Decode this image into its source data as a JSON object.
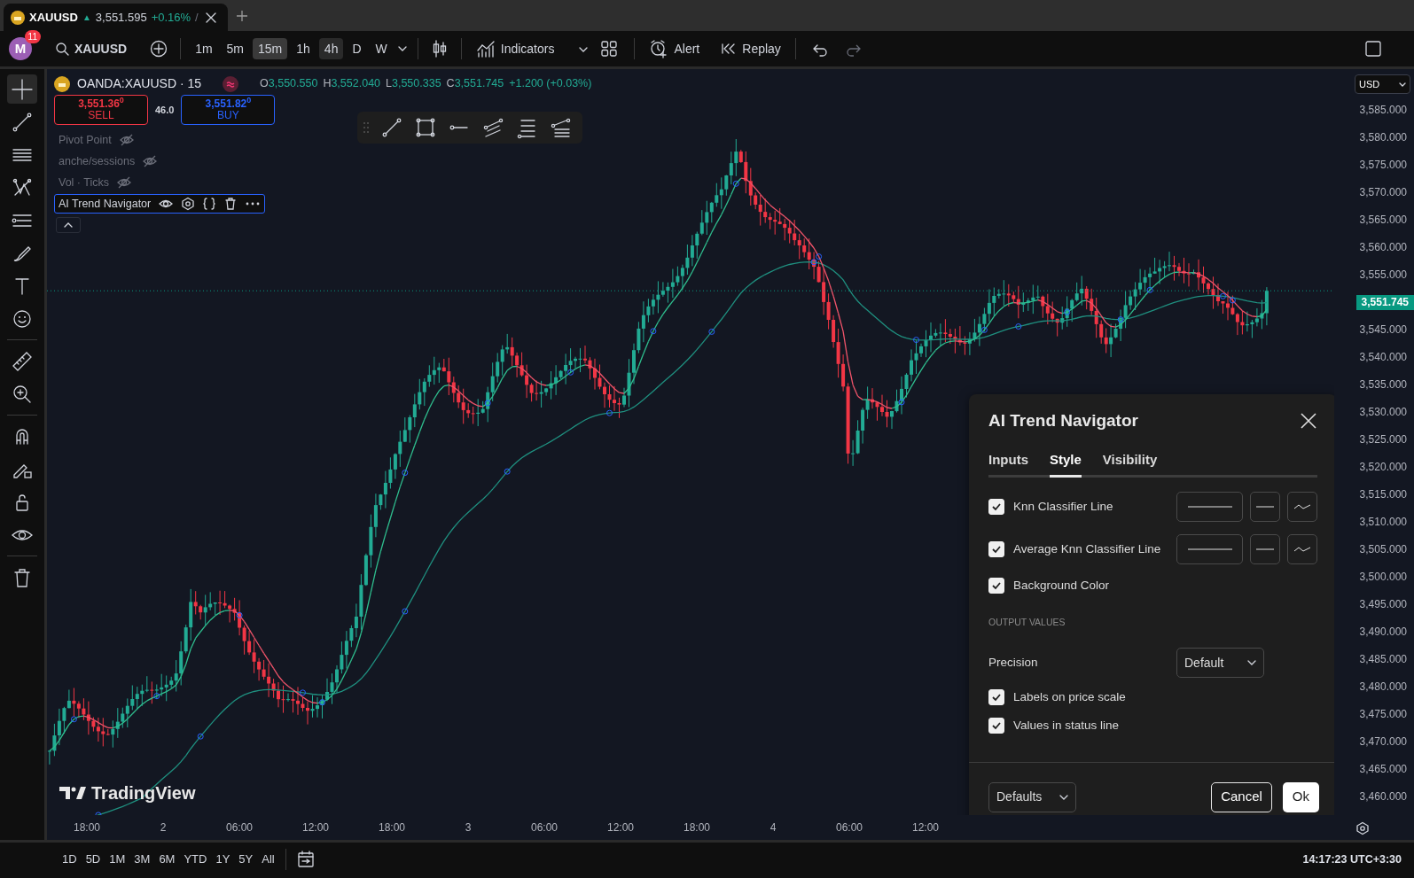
{
  "browser_tab": {
    "symbol": "XAUUSD",
    "arrow": "▲",
    "price": "3,551.595",
    "change": "+0.16%",
    "suffix": "/"
  },
  "toolbar": {
    "avatar": "M",
    "notifications": "11",
    "symbol": "XAUUSD",
    "intervals": [
      {
        "label": "1m",
        "selected": false,
        "highlighted": false
      },
      {
        "label": "5m",
        "selected": false,
        "highlighted": false
      },
      {
        "label": "15m",
        "selected": true,
        "highlighted": false
      },
      {
        "label": "1h",
        "selected": false,
        "highlighted": false
      },
      {
        "label": "4h",
        "selected": false,
        "highlighted": true
      },
      {
        "label": "D",
        "selected": false,
        "highlighted": false
      },
      {
        "label": "W",
        "selected": false,
        "highlighted": false
      }
    ],
    "indicators": "Indicators",
    "alert": "Alert",
    "replay": "Replay"
  },
  "legend": {
    "title": "OANDA:XAUUSD · 15",
    "ohlc": [
      {
        "key": "O",
        "value": "3,550.550"
      },
      {
        "key": "H",
        "value": "3,552.040"
      },
      {
        "key": "L",
        "value": "3,550.335"
      },
      {
        "key": "C",
        "value": "3,551.745"
      }
    ],
    "change": "+1.200 (+0.03%)",
    "sell": {
      "price": "3,551.36$^{0}$",
      "label": "SELL"
    },
    "spread": "46.0",
    "buy": {
      "price": "3,551.82$^{0}$",
      "label": "BUY"
    },
    "indicators": [
      {
        "name": "Pivot Point",
        "hidden": true,
        "selected": false
      },
      {
        "name": "anche/sessions",
        "hidden": true,
        "selected": false
      },
      {
        "name": "Vol · Ticks",
        "hidden": true,
        "selected": false
      },
      {
        "name": "AI Trend Navigator",
        "hidden": false,
        "selected": true
      }
    ]
  },
  "price_axis": {
    "currency": "USD",
    "ticks": [
      {
        "kind": "tick",
        "text": "3,585.000"
      },
      {
        "kind": "tick",
        "text": "3,580.000"
      },
      {
        "kind": "tick",
        "text": "3,575.000"
      },
      {
        "kind": "tick",
        "text": "3,570.000"
      },
      {
        "kind": "tick",
        "text": "3,565.000"
      },
      {
        "kind": "tick",
        "text": "3,560.000"
      },
      {
        "kind": "tick",
        "text": "3,555.000"
      },
      {
        "kind": "current",
        "text": "3,551.745"
      },
      {
        "kind": "tick",
        "text": "3,545.000"
      },
      {
        "kind": "tick",
        "text": "3,540.000"
      },
      {
        "kind": "tick",
        "text": "3,535.000"
      },
      {
        "kind": "tick",
        "text": "3,530.000"
      },
      {
        "kind": "tick",
        "text": "3,525.000"
      },
      {
        "kind": "tick",
        "text": "3,520.000"
      },
      {
        "kind": "tick",
        "text": "3,515.000"
      },
      {
        "kind": "tick",
        "text": "3,510.000"
      },
      {
        "kind": "tick",
        "text": "3,505.000"
      },
      {
        "kind": "tick",
        "text": "3,500.000"
      },
      {
        "kind": "tick",
        "text": "3,495.000"
      },
      {
        "kind": "tick",
        "text": "3,490.000"
      },
      {
        "kind": "tick",
        "text": "3,485.000"
      },
      {
        "kind": "tick",
        "text": "3,480.000"
      },
      {
        "kind": "tick",
        "text": "3,475.000"
      },
      {
        "kind": "tick",
        "text": "3,470.000"
      },
      {
        "kind": "tick",
        "text": "3,465.000"
      },
      {
        "kind": "tick",
        "text": "3,460.000"
      }
    ]
  },
  "time_axis": [
    "18:00",
    "2",
    "06:00",
    "12:00",
    "18:00",
    "3",
    "06:00",
    "12:00",
    "18:00",
    "4",
    "06:00",
    "12:00"
  ],
  "chart_logo": "TradingView",
  "dialog": {
    "title": "AI Trend Navigator",
    "tabs": [
      {
        "label": "Inputs",
        "selected": false
      },
      {
        "label": "Style",
        "selected": true
      },
      {
        "label": "Visibility",
        "selected": false
      }
    ],
    "rows": [
      {
        "kind": "plot",
        "label": "Knn Classifier Line",
        "checked": true
      },
      {
        "kind": "plot",
        "label": "Average Knn Classifier Line",
        "checked": true
      },
      {
        "kind": "checkbox",
        "label": "Background Color",
        "checked": true
      },
      {
        "kind": "section",
        "label": "OUTPUT VALUES"
      },
      {
        "kind": "select",
        "label": "Precision",
        "value": "Default"
      },
      {
        "kind": "checkbox",
        "label": "Labels on price scale",
        "checked": true
      },
      {
        "kind": "checkbox",
        "label": "Values in status line",
        "checked": true
      }
    ],
    "defaults": "Defaults",
    "cancel": "Cancel",
    "ok": "Ok"
  },
  "range_buttons": [
    "1D",
    "5D",
    "1M",
    "3M",
    "6M",
    "YTD",
    "1Y",
    "5Y",
    "All"
  ],
  "clock": "14:17:23 UTC+3:30"
}
